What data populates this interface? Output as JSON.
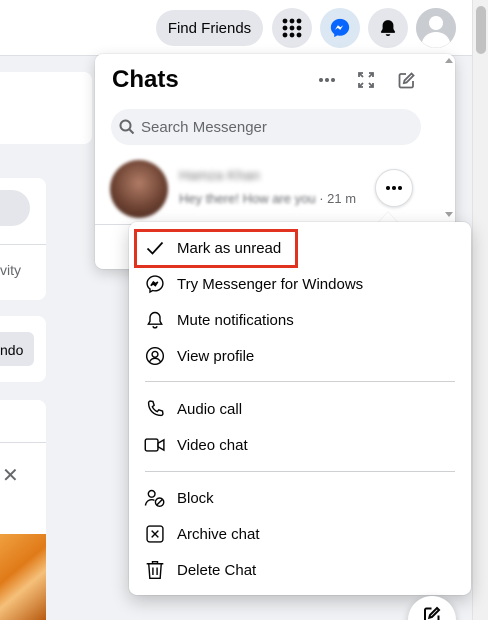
{
  "topbar": {
    "find_friends_label": "Find Friends"
  },
  "left_content": {
    "partial_activity": "vity",
    "partial_button": "ndo",
    "close_glyph": "✕"
  },
  "chats": {
    "title": "Chats",
    "search_placeholder": "Search Messenger",
    "conversation": {
      "name": "Hamza Khan",
      "preview": "Hey there! How are you",
      "time": "· 21 m"
    }
  },
  "context_menu": {
    "items": [
      {
        "label": "Mark as unread",
        "icon": "check-icon"
      },
      {
        "label": "Try Messenger for Windows",
        "icon": "messenger-icon"
      },
      {
        "label": "Mute notifications",
        "icon": "bell-icon"
      },
      {
        "label": "View profile",
        "icon": "profile-icon"
      },
      {
        "label": "Audio call",
        "icon": "phone-icon"
      },
      {
        "label": "Video chat",
        "icon": "video-icon"
      },
      {
        "label": "Block",
        "icon": "block-user-icon"
      },
      {
        "label": "Archive chat",
        "icon": "archive-icon"
      },
      {
        "label": "Delete Chat",
        "icon": "trash-icon"
      }
    ]
  },
  "colors": {
    "accent": "#0866ff",
    "highlight": "#e0321f",
    "page_bg": "#f0f2f5"
  }
}
